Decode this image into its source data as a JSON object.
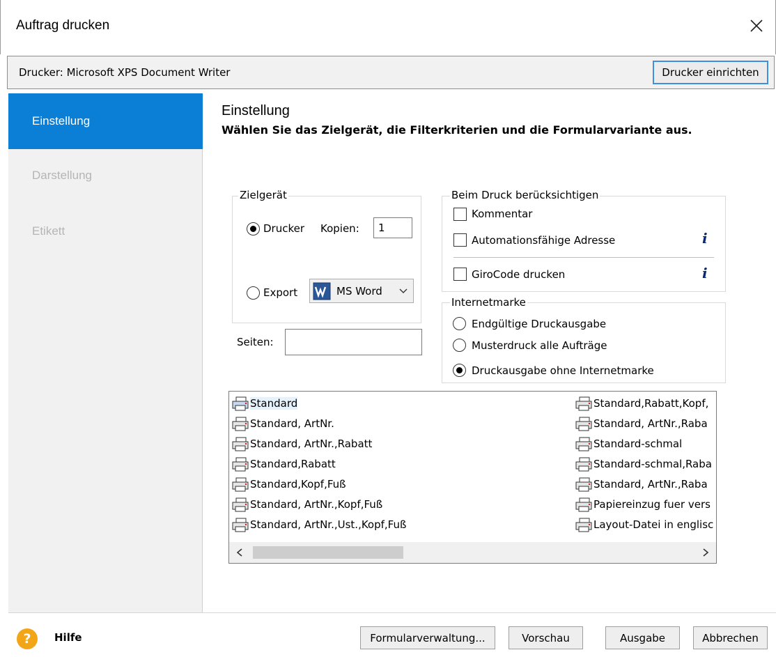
{
  "window": {
    "title": "Auftrag drucken"
  },
  "printer": {
    "label": "Drucker:  Microsoft XPS Document Writer",
    "setup_button": "Drucker einrichten"
  },
  "sidebar": {
    "items": [
      {
        "label": "Einstellung",
        "active": true
      },
      {
        "label": "Darstellung",
        "active": false
      },
      {
        "label": "Etikett",
        "active": false
      }
    ]
  },
  "main": {
    "heading": "Einstellung",
    "subheading": "Wählen Sie das Zielgerät, die Filterkriterien und die Formularvariante aus."
  },
  "zielgeraet": {
    "title": "Zielgerät",
    "drucker_label": "Drucker",
    "drucker_selected": true,
    "kopien_label": "Kopien:",
    "kopien_value": "1",
    "export_label": "Export",
    "export_format": "MS Word"
  },
  "seiten": {
    "label": "Seiten:",
    "value": ""
  },
  "beim_druck": {
    "title": "Beim Druck berücksichtigen",
    "kommentar": "Kommentar",
    "adresse": "Automationsfähige Adresse",
    "girocode": "GiroCode drucken"
  },
  "internetmarke": {
    "title": "Internetmarke",
    "options": [
      {
        "label": "Endgültige Druckausgabe",
        "selected": false
      },
      {
        "label": "Musterdruck alle Aufträge",
        "selected": false
      },
      {
        "label": "Druckausgabe ohne Internetmarke",
        "selected": true
      }
    ]
  },
  "forms": {
    "col1": [
      "Standard",
      "Standard, ArtNr.",
      "Standard, ArtNr.,Rabatt",
      "Standard,Rabatt",
      "Standard,Kopf,Fuß",
      "Standard, ArtNr.,Kopf,Fuß",
      "Standard, ArtNr.,Ust.,Kopf,Fuß"
    ],
    "col2": [
      "Standard,Rabatt,Kopf,",
      "Standard, ArtNr.,Raba",
      "Standard-schmal",
      "Standard-schmal,Raba",
      "Standard, ArtNr.,Raba",
      "Papiereinzug fuer vers",
      "Layout-Datei in englisc"
    ],
    "selected": "Standard"
  },
  "footer": {
    "help": "Hilfe",
    "help_icon_glyph": "?",
    "formular": "Formularverwaltung...",
    "vorschau": "Vorschau",
    "ausgabe": "Ausgabe",
    "abbrechen": "Abbrechen"
  },
  "colors": {
    "accent": "#0b7fd5",
    "focus_border": "#3f8fe0",
    "help_icon": "#f2a516"
  }
}
